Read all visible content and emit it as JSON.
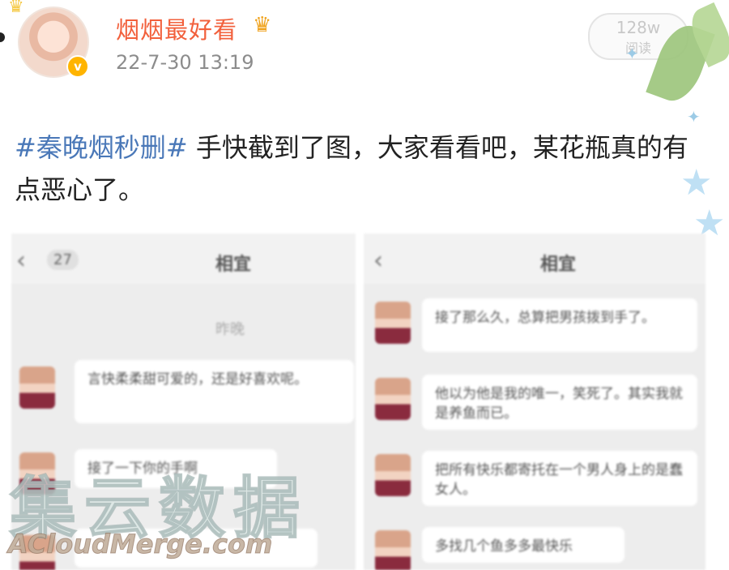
{
  "header": {
    "username": "烟烟最好看",
    "crown_icon": "crown-icon",
    "timestamp": "22-7-30 13:19",
    "read_count": "128w",
    "read_label": "阅读"
  },
  "post": {
    "hashtag": "#秦晚烟秒删#",
    "body": " 手快截到了图，大家看看吧，某花瓶真的有点恶心了。"
  },
  "screenshot_left": {
    "back_count": "27",
    "title": "相宜",
    "time_divider": "昨晚",
    "messages": [
      "言快柔柔甜可爱的，还是好喜欢呢。",
      "接了一下你的手啊",
      ""
    ]
  },
  "screenshot_right": {
    "title": "相宜",
    "messages": [
      "接了那么久，总算把男孩拨到手了。",
      "他以为他是我的唯一，笑死了。其实我就是养鱼而已。",
      "把所有快乐都寄托在一个男人身上的是蠢女人。",
      "多找几个鱼多多最快乐"
    ]
  },
  "watermark": {
    "cn": "集云数据",
    "en": "ACloudMerge.com"
  },
  "colors": {
    "username": "#f2603c",
    "hashtag": "#4a78b8",
    "verified": "#ffb400"
  }
}
